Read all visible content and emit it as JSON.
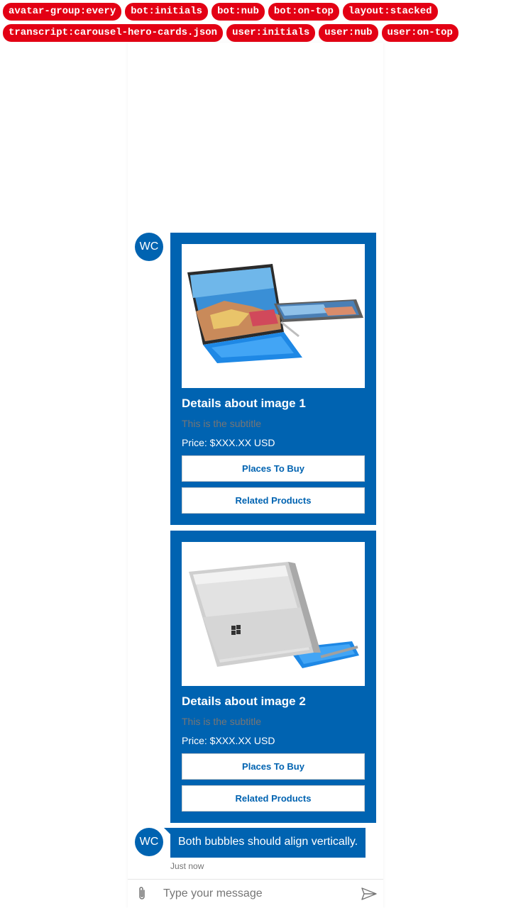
{
  "tags": {
    "row1": [
      "avatar-group:every",
      "bot:initials",
      "bot:nub",
      "bot:on-top",
      "layout:stacked"
    ],
    "row2": [
      "transcript:carousel-hero-cards.json",
      "user:initials",
      "user:nub",
      "user:on-top"
    ]
  },
  "colors": {
    "accent": "#0063b1",
    "tag": "#e30014",
    "muted": "#767676"
  },
  "bot": {
    "initials": "WC"
  },
  "cards": [
    {
      "image_alt": "surface-pro-4-blue-keyboard",
      "title": "Details about image 1",
      "subtitle": "This is the subtitle",
      "text": "Price: $XXX.XX USD",
      "buttons": [
        "Places To Buy",
        "Related Products"
      ]
    },
    {
      "image_alt": "surface-pro-4-silver-back",
      "title": "Details about image 2",
      "subtitle": "This is the subtitle",
      "text": "Price: $XXX.XX USD",
      "buttons": [
        "Places To Buy",
        "Related Products"
      ]
    }
  ],
  "message": {
    "text": "Both bubbles should align vertically.",
    "timestamp": "Just now"
  },
  "composer": {
    "placeholder": "Type your message",
    "attach_icon": "paperclip-icon",
    "send_icon": "send-icon"
  }
}
